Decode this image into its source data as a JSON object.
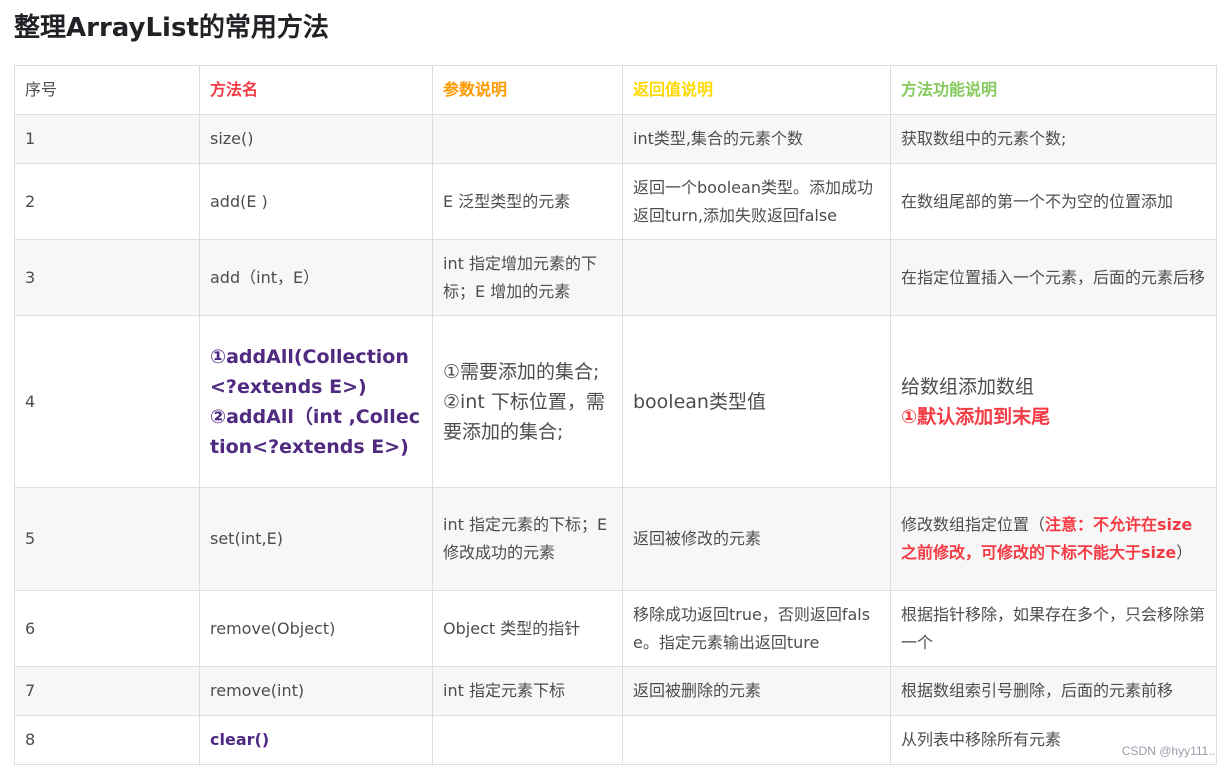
{
  "title": "整理ArrayList的常用方法",
  "headers": [
    "序号",
    "方法名",
    "参数说明",
    "返回值说明",
    "方法功能说明"
  ],
  "rows": [
    {
      "no": "1",
      "method": "size()",
      "param": "",
      "ret": "int类型,集合的元素个数",
      "func": "获取数组中的元素个数;"
    },
    {
      "no": "2",
      "method": "add(E )",
      "param": "E  泛型类型的元素",
      "ret": "返回一个boolean类型。添加成功返回turn,添加失败返回false",
      "func": "在数组尾部的第一个不为空的位置添加"
    },
    {
      "no": "3",
      "method": "add（int，E）",
      "param": "int 指定增加元素的下标；E 增加的元素",
      "ret": "",
      "func": "在指定位置插入一个元素，后面的元素后移"
    },
    {
      "no": "4",
      "method_line1": "①addAll(Collection<?extends E>)",
      "method_line2": "②addAll（int ,Collection<?extends E>)",
      "param": "①需要添加的集合;②int  下标位置，需要添加的集合;",
      "ret": "boolean类型值",
      "func": "给数组添加数组",
      "func_note": "①默认添加到末尾"
    },
    {
      "no": "5",
      "method": "set(int,E)",
      "param": "int 指定元素的下标；E  修改成功的元素",
      "ret": "返回被修改的元素",
      "func_pre": "修改数组指定位置（",
      "func_note": "注意：不允许在size之前修改，可修改的下标不能大于size",
      "func_post": "）"
    },
    {
      "no": "6",
      "method": "remove(Object)",
      "param": "Object 类型的指针",
      "ret": "移除成功返回true，否则返回false。指定元素输出返回ture",
      "func": "根据指针移除，如果存在多个，只会移除第一个"
    },
    {
      "no": "7",
      "method": "remove(int)",
      "param": "int 指定元素下标",
      "ret": "返回被删除的元素",
      "func": "根据数组索引号删除，后面的元素前移"
    },
    {
      "no": "8",
      "method": "clear()",
      "param": "",
      "ret": "",
      "func": "从列表中移除所有元素"
    }
  ],
  "watermark": "CSDN @hyy111.."
}
